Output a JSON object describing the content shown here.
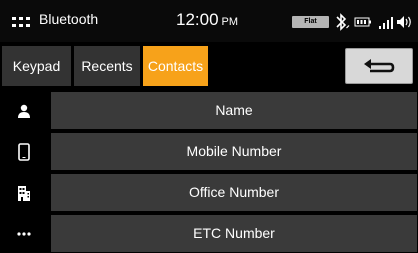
{
  "status": {
    "title": "Bluetooth",
    "time": "12:00",
    "ampm": "PM",
    "flat_label": "Flat",
    "icons": [
      "apps-icon",
      "bluetooth-icon",
      "battery-icon",
      "signal-icon",
      "volume-icon"
    ]
  },
  "tabs": [
    {
      "label": "Keypad",
      "active": false
    },
    {
      "label": "Recents",
      "active": false
    },
    {
      "label": "Contacts",
      "active": true
    }
  ],
  "back_icon": "back-arrow-icon",
  "accent_color": "#f7a21a",
  "fields": [
    {
      "label": "Name",
      "icon": "person-icon"
    },
    {
      "label": "Mobile Number",
      "icon": "mobile-phone-icon"
    },
    {
      "label": "Office Number",
      "icon": "office-building-icon"
    },
    {
      "label": "ETC Number",
      "icon": "more-dots-icon"
    }
  ]
}
